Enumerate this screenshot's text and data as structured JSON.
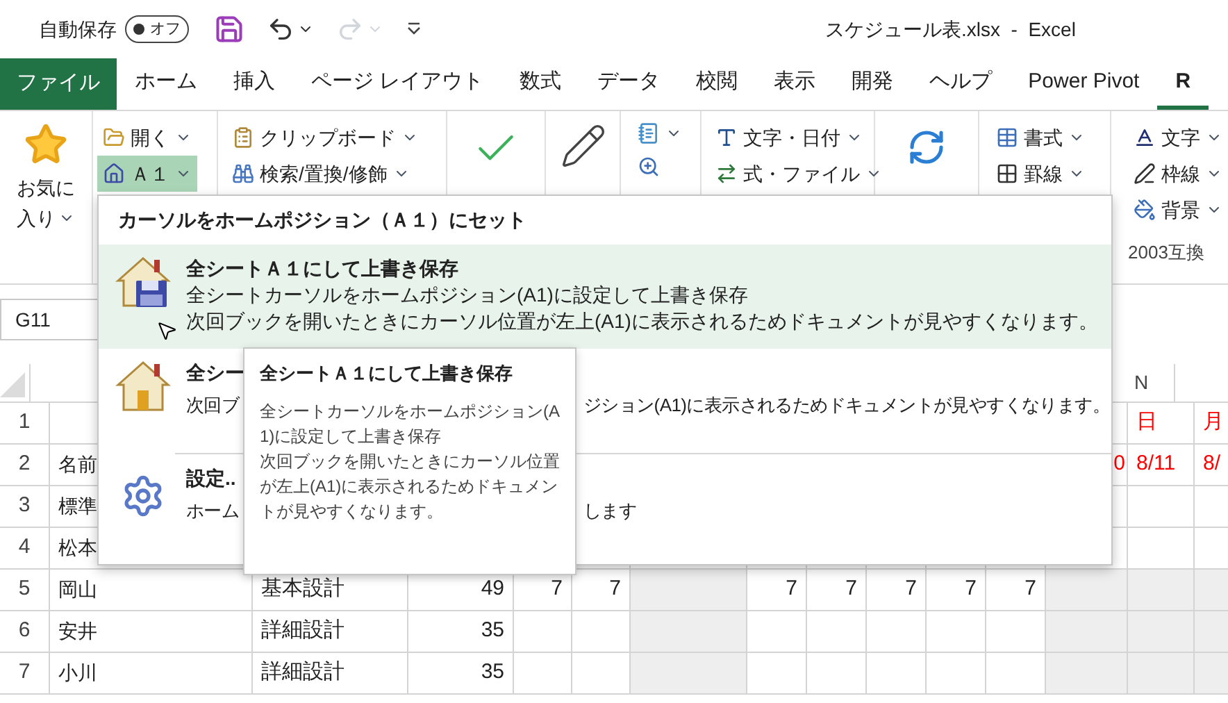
{
  "title_bar": {
    "autosave_label": "自動保存",
    "autosave": {
      "label": "オフ",
      "on": false
    },
    "title": "スケジュール表.xlsx  -  Excel"
  },
  "quick_access": [
    {
      "kind": "save"
    },
    {
      "kind": "undo",
      "disabled": false
    },
    {
      "kind": "redo",
      "disabled": true
    },
    {
      "kind": "customize"
    }
  ],
  "tabs": [
    {
      "label": "ファイル",
      "kind": "file",
      "selected": false
    },
    {
      "label": "ホーム",
      "kind": "tab",
      "selected": false
    },
    {
      "label": "挿入",
      "kind": "tab",
      "selected": false
    },
    {
      "label": "ページ レイアウト",
      "kind": "tab",
      "selected": false
    },
    {
      "label": "数式",
      "kind": "tab",
      "selected": false
    },
    {
      "label": "データ",
      "kind": "tab",
      "selected": false
    },
    {
      "label": "校閲",
      "kind": "tab",
      "selected": false
    },
    {
      "label": "表示",
      "kind": "tab",
      "selected": false
    },
    {
      "label": "開発",
      "kind": "tab",
      "selected": false
    },
    {
      "label": "ヘルプ",
      "kind": "tab",
      "selected": false
    },
    {
      "label": "Power Pivot",
      "kind": "tab",
      "selected": false
    },
    {
      "label": "R",
      "kind": "tab",
      "selected": true
    }
  ],
  "ribbon": {
    "favorites": [
      "お気に",
      "入り"
    ],
    "open": "開く",
    "a1": {
      "label": "Ａ１",
      "selected": true
    },
    "clipboard": "クリップボード",
    "search": "検索/置換/修飾",
    "text_date": "文字・日付",
    "formula_file": "式・ファイル",
    "format": "書式",
    "border": "罫線",
    "font_color": "文字",
    "frame": "枠線",
    "background": "背景",
    "group_label": "2003互換"
  },
  "name_box": "G11",
  "column_header": "N",
  "rows": [
    {
      "number": "1",
      "cells": [
        {},
        {},
        {},
        {},
        {},
        {},
        {},
        {},
        {},
        {},
        {},
        {},
        {
          "text": "日",
          "color": "#ff0000"
        },
        {
          "text": "月",
          "color": "#ff0000"
        }
      ]
    },
    {
      "number": "2",
      "cells": [
        {
          "text": "名前"
        },
        {},
        {},
        {},
        {},
        {},
        {},
        {},
        {},
        {},
        {},
        {
          "text": "0",
          "color": "#ff0000"
        },
        {
          "text": "8/11",
          "color": "#ff0000"
        },
        {
          "text": "8/",
          "color": "#ff0000"
        }
      ]
    },
    {
      "number": "3",
      "cells": [
        {
          "text": "標準"
        },
        {},
        {},
        {},
        {},
        {},
        {},
        {},
        {},
        {},
        {},
        {},
        {},
        {}
      ]
    },
    {
      "number": "4",
      "cells": [
        {
          "text": "松本"
        },
        {},
        {},
        {},
        {},
        {},
        {},
        {},
        {},
        {},
        {},
        {},
        {},
        {}
      ]
    },
    {
      "number": "5",
      "cells": [
        {
          "text": "岡山"
        },
        {
          "text": "基本設計"
        },
        {
          "text": "49"
        },
        {
          "text": "7"
        },
        {
          "text": "7"
        },
        {
          "shaded": true
        },
        {
          "text": "7"
        },
        {
          "text": "7"
        },
        {
          "text": "7"
        },
        {
          "text": "7"
        },
        {
          "text": "7"
        },
        {
          "shaded": true
        },
        {
          "shaded": true
        },
        {
          "shaded": true
        }
      ]
    },
    {
      "number": "6",
      "cells": [
        {
          "text": "安井"
        },
        {
          "text": "詳細設計"
        },
        {
          "text": "35"
        },
        {},
        {},
        {
          "shaded": true
        },
        {},
        {},
        {},
        {},
        {},
        {
          "shaded": true
        },
        {
          "shaded": true
        },
        {
          "shaded": true
        }
      ]
    },
    {
      "number": "7",
      "cells": [
        {
          "text": "小川"
        },
        {
          "text": "詳細設計"
        },
        {
          "text": "35"
        },
        {},
        {},
        {
          "shaded": true
        },
        {},
        {},
        {},
        {},
        {},
        {
          "shaded": true
        },
        {
          "shaded": true
        },
        {
          "shaded": true
        }
      ]
    }
  ],
  "menu": {
    "header": "カーソルをホームポジション（Ａ１）にセット",
    "items": [
      {
        "kind": "save_all",
        "selected": true,
        "title": "全シートＡ１にして上書き保存",
        "description": [
          "全シートカーソルをホームポジション(A1)に設定して上書き保存",
          "次回ブックを開いたときにカーソル位置が左上(A1)に表示されるためドキュメントが見やすくなります。"
        ]
      },
      {
        "kind": "home",
        "selected": false,
        "title": "全シー",
        "description_parts": [
          "次回ブ",
          "ジション(A1)に表示されるためドキュメントが見やすくなります。"
        ]
      },
      {
        "kind": "settings",
        "selected": false,
        "title": "設定..",
        "description_parts": [
          "ホーム",
          "します"
        ]
      }
    ]
  },
  "tooltip": {
    "title": "全シートＡ１にして上書き保存",
    "description": [
      "全シートカーソルをホームポジション(A1)に設定して上書き保存",
      "次回ブックを開いたときにカーソル位置が左上(A1)に表示されるためドキュメントが見やすくなります。"
    ]
  }
}
